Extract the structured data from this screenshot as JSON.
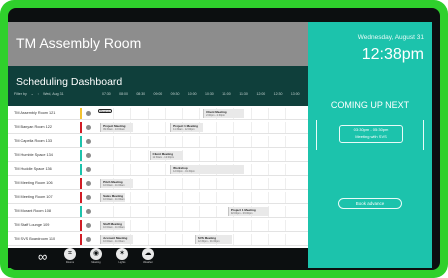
{
  "room": {
    "title": "TM Assembly Room"
  },
  "schedule": {
    "title": "Scheduling Dashboard",
    "filter_label": "Filter by",
    "filter_value": "Wed, Aug 31",
    "times": [
      "07:30",
      "08:00",
      "08:30",
      "09:00",
      "09:30",
      "10:00",
      "10:30",
      "11:00",
      "11:30",
      "12:00",
      "12:30",
      "13:00"
    ]
  },
  "rooms": [
    {
      "name": "TM Assembly Room 121",
      "status": "#f2c230",
      "chip": "Reserve",
      "meetings": [
        {
          "title": "Client Meeting",
          "sub": "2:00pm - 2:30pm",
          "start": 0.52,
          "end": 0.72
        }
      ]
    },
    {
      "name": "TM Banyan Room 122",
      "status": "#d11c25",
      "chip": "",
      "meetings": [
        {
          "title": "Project Meeting",
          "sub": "09:30am - 10:00am",
          "start": 0.02,
          "end": 0.18
        },
        {
          "title": "Project 1 Meeting",
          "sub": "11:30am - 12:00pm",
          "start": 0.36,
          "end": 0.52
        }
      ]
    },
    {
      "name": "TM Capella Room 133",
      "status": "#1cc3ac",
      "chip": "",
      "meetings": []
    },
    {
      "name": "TM Humble Space 134",
      "status": "#1cc3ac",
      "chip": "",
      "meetings": [
        {
          "title": "Client Meeting",
          "sub": "11:30am - 12:00pm",
          "start": 0.26,
          "end": 0.42
        }
      ]
    },
    {
      "name": "TM Huddle Space 136",
      "status": "#1cc3ac",
      "chip": "",
      "meetings": [
        {
          "title": "Workshop",
          "sub": "12:00pm - 01:30pm",
          "start": 0.36,
          "end": 0.72
        }
      ]
    },
    {
      "name": "TM Meeting Room 106",
      "status": "#d11c25",
      "chip": "",
      "meetings": [
        {
          "title": "Pitch Meeting",
          "sub": "10:00am - 11:00am",
          "start": 0.02,
          "end": 0.18
        }
      ]
    },
    {
      "name": "TM Meeting Room 107",
      "status": "#d11c25",
      "chip": "",
      "meetings": [
        {
          "title": "Sales Meeting",
          "sub": "10:00am - 11:00am",
          "start": 0.02,
          "end": 0.14
        }
      ]
    },
    {
      "name": "TM Morant Room 108",
      "status": "#1cc3ac",
      "chip": "",
      "meetings": [
        {
          "title": "Project 1 Meeting",
          "sub": "02:00pm - 03:00pm",
          "start": 0.64,
          "end": 0.84
        }
      ]
    },
    {
      "name": "TM Staff Lounge 109",
      "status": "#d11c25",
      "chip": "",
      "meetings": [
        {
          "title": "Staff Meeting",
          "sub": "10:00am - 11:00am",
          "start": 0.02,
          "end": 0.14
        }
      ]
    },
    {
      "name": "TM SVS Boardroom 110",
      "status": "#d11c25",
      "chip": "",
      "meetings": [
        {
          "title": "Account Meeting",
          "sub": "10:00am - 11:00am",
          "start": 0.02,
          "end": 0.18
        },
        {
          "title": "SVS Meeting",
          "sub": "12:30pm - 01:30pm",
          "start": 0.48,
          "end": 0.66
        }
      ]
    }
  ],
  "bottom_bar": {
    "apps": [
      {
        "icon": "grid-icon",
        "glyph": "⌗",
        "label": "Rooms"
      },
      {
        "icon": "zoom-icon",
        "glyph": "◉",
        "label": "Meeting"
      },
      {
        "icon": "lightbulb-icon",
        "glyph": "✶",
        "label": "Lights"
      },
      {
        "icon": "weather-icon",
        "glyph": "☁",
        "label": "Weather"
      }
    ]
  },
  "right_panel": {
    "date": "Wednesday, August 31",
    "time": "12:38pm",
    "coming_up": "COMING UP NEXT",
    "next_time": "03:30pm - 05:30pm",
    "next_title": "Meeting with SVS",
    "book_label": "Book advance"
  },
  "colors": {
    "accent": "#1cc3ac",
    "header_gray": "#8d8d8d",
    "dark_teal": "#0f3f3b",
    "bezel": "#2fd02c"
  }
}
